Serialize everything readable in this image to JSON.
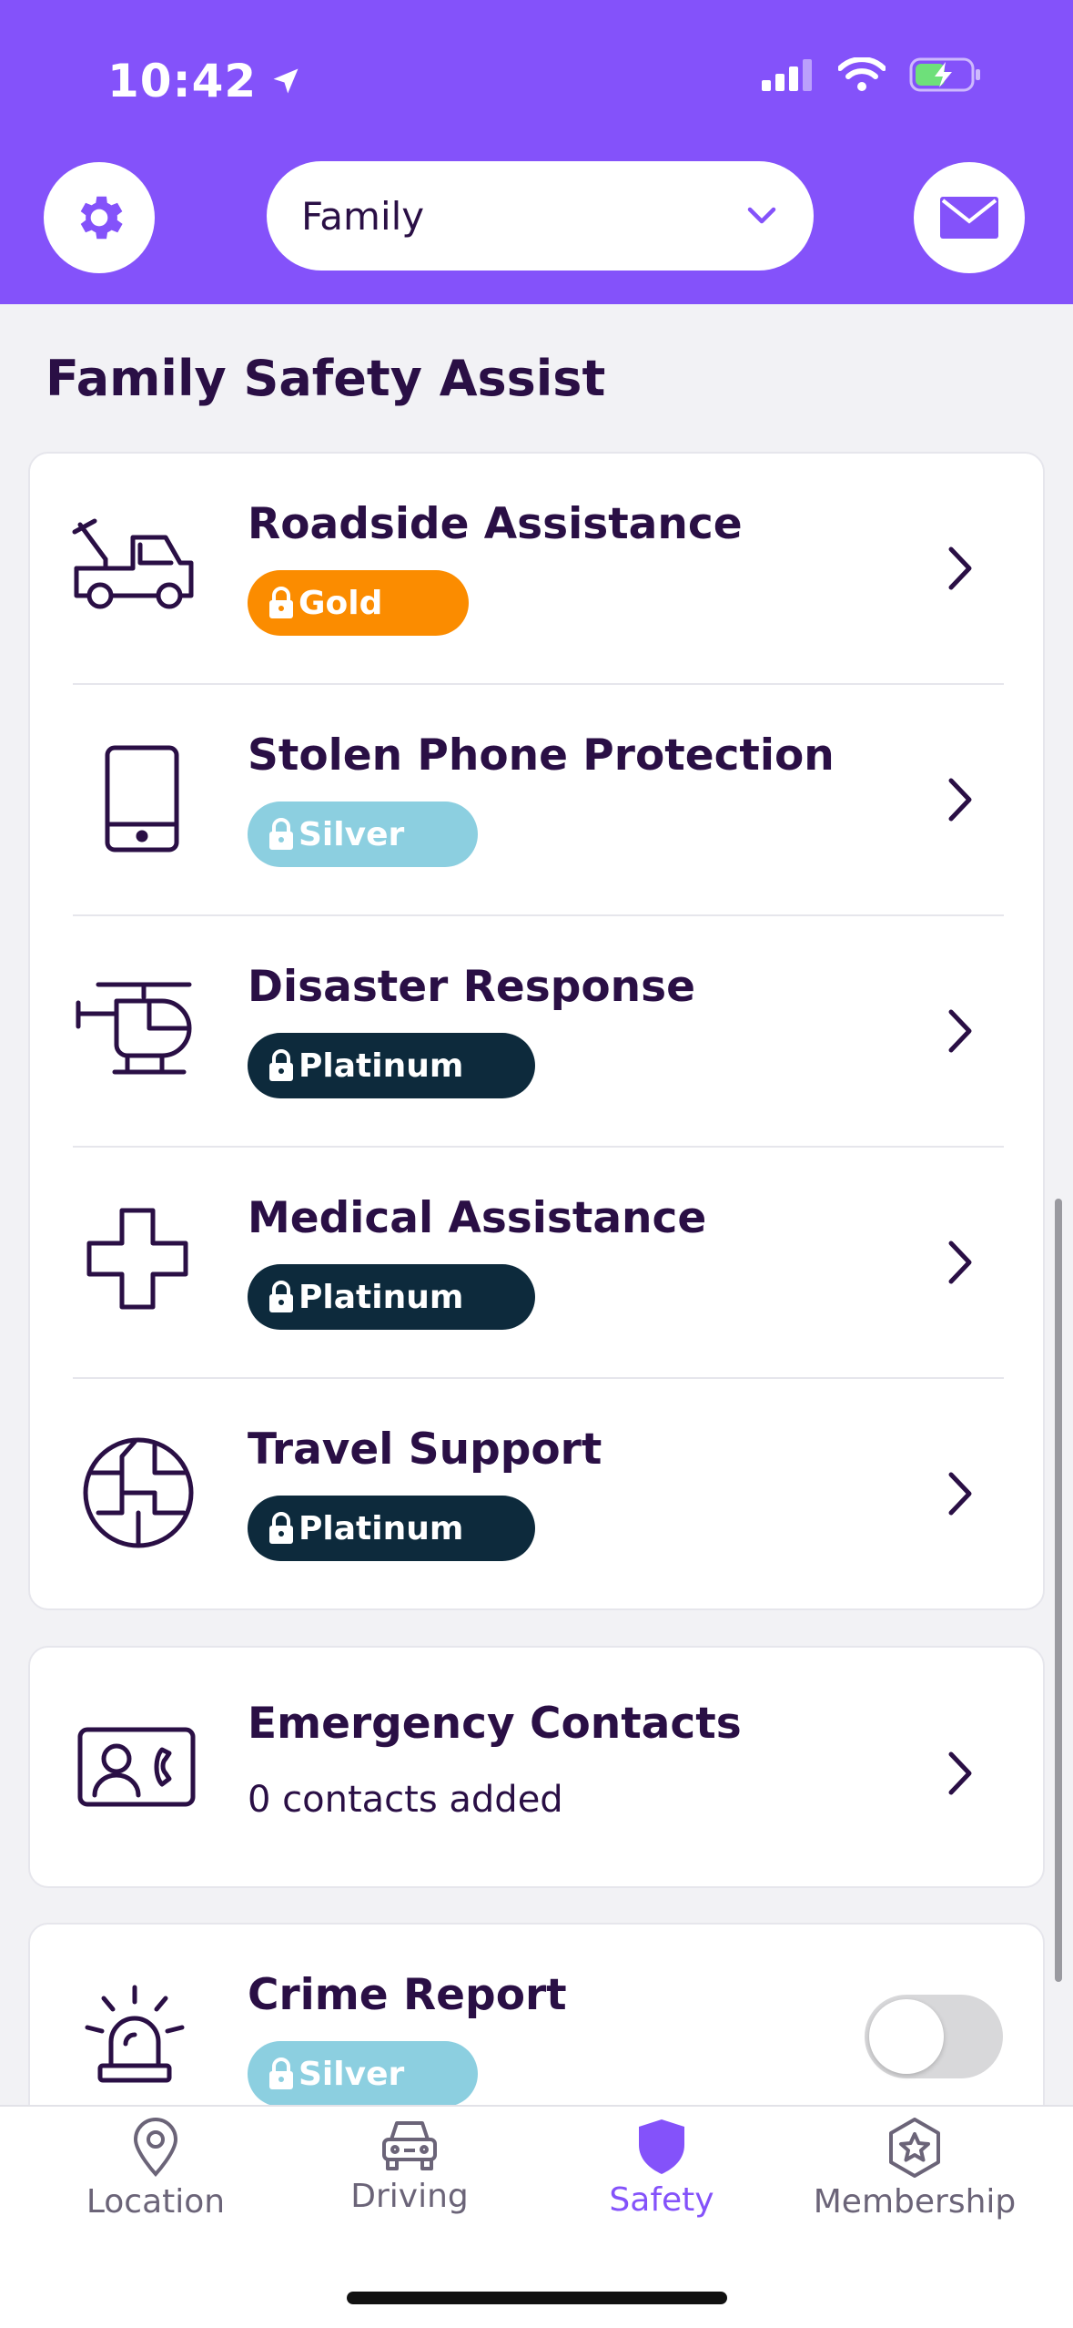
{
  "status_bar": {
    "time": "10:42"
  },
  "header": {
    "circle_selector": {
      "value": "Family"
    },
    "settings_icon": "gear-icon",
    "messages_icon": "mail-icon",
    "accent_color": "#8452fa"
  },
  "section_title": "Family Safety Assist",
  "safety_items": [
    {
      "title": "Roadside Assistance",
      "badge": "Gold",
      "icon": "tow-truck-icon",
      "badge_color": "#fb8c00"
    },
    {
      "title": "Stolen Phone Protection",
      "badge": "Silver",
      "icon": "phone-icon",
      "badge_color": "#8ccfe0"
    },
    {
      "title": "Disaster Response",
      "badge": "Platinum",
      "icon": "helicopter-icon",
      "badge_color": "#0d2a3c"
    },
    {
      "title": "Medical Assistance",
      "badge": "Platinum",
      "icon": "medical-cross-icon",
      "badge_color": "#0d2a3c"
    },
    {
      "title": "Travel Support",
      "badge": "Platinum",
      "icon": "globe-icon",
      "badge_color": "#0d2a3c"
    }
  ],
  "emergency_contacts": {
    "title": "Emergency Contacts",
    "subtitle": "0 contacts added",
    "icon": "contact-card-icon"
  },
  "crime_report": {
    "title": "Crime Report",
    "badge": "Silver",
    "icon": "siren-icon",
    "toggle_on": false
  },
  "tabs": [
    {
      "label": "Location",
      "icon": "location-pin-icon",
      "active": false
    },
    {
      "label": "Driving",
      "icon": "car-icon",
      "active": false
    },
    {
      "label": "Safety",
      "icon": "shield-icon",
      "active": true
    },
    {
      "label": "Membership",
      "icon": "star-badge-icon",
      "active": false
    }
  ]
}
